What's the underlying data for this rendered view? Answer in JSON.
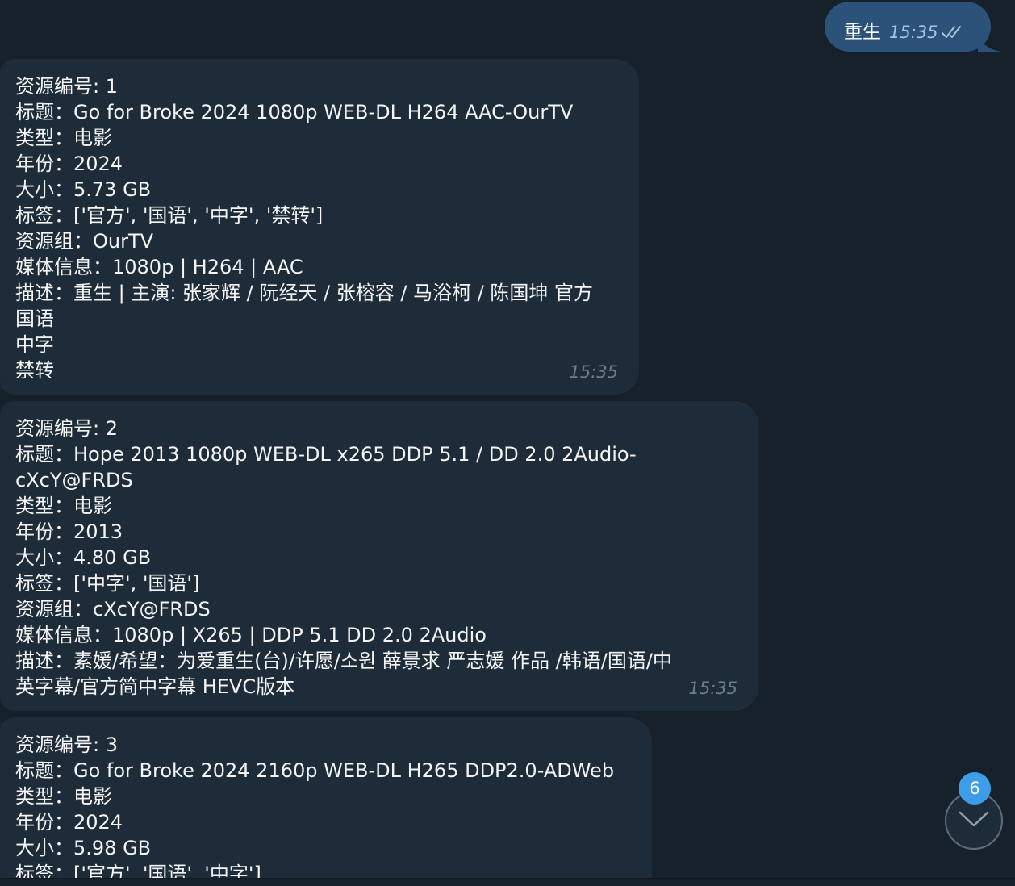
{
  "outgoing": {
    "text": "重生",
    "time": "15:35"
  },
  "messages": [
    {
      "lines": [
        "资源编号: 1",
        "标题：Go for Broke 2024 1080p WEB-DL H264 AAC-OurTV",
        "类型：电影",
        "年份：2024",
        "大小：5.73 GB",
        "标签：['官方', '国语', '中字', '禁转']",
        "资源组：OurTV",
        "媒体信息：1080p | H264 | AAC",
        "描述：重生 | 主演: 张家辉 / 阮经天 / 张榕容 / 马浴柯 / 陈国坤 官方",
        "国语",
        "中字",
        "禁转"
      ],
      "time": "15:35"
    },
    {
      "lines": [
        "资源编号: 2",
        "标题：Hope 2013 1080p WEB-DL x265 DDP 5.1 / DD 2.0 2Audio-",
        "cXcY@FRDS",
        "类型：电影",
        "年份：2013",
        "大小：4.80 GB",
        "标签：['中字', '国语']",
        "资源组：cXcY@FRDS",
        "媒体信息：1080p | X265 | DDP 5.1 DD 2.0 2Audio",
        "描述：素媛/希望：为爱重生(台)/许愿/소원 薛景求 严志媛 作品 /韩语/国语/中",
        "英字幕/官方简中字幕 HEVC版本"
      ],
      "time": "15:35"
    },
    {
      "lines": [
        "资源编号: 3",
        "标题：Go for Broke 2024 2160p WEB-DL H265 DDP2.0-ADWeb",
        "类型：电影",
        "年份：2024",
        "大小：5.98 GB",
        "标签：['官方', '国语', '中字']"
      ],
      "time": ""
    }
  ],
  "scroll": {
    "unread_count": "6"
  },
  "colors": {
    "background": "#17212b",
    "incoming_bubble": "#1e2c3a",
    "outgoing_bubble": "#2b5278",
    "badge": "#3e9de8"
  }
}
